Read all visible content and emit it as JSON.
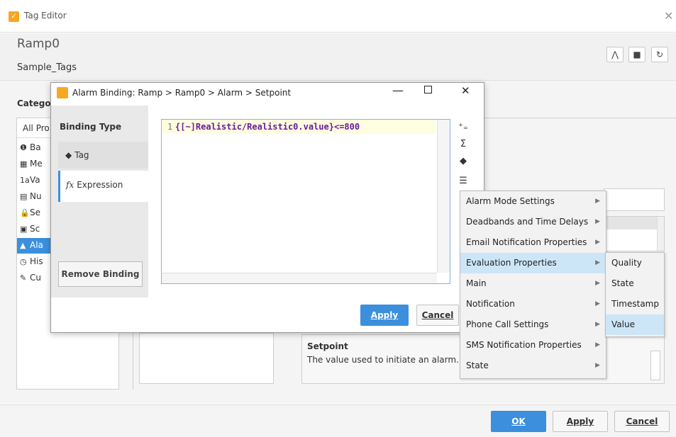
{
  "tag_editor": {
    "window_title": "Tag Editor",
    "tag_name": "Ramp0",
    "tag_path": "Sample_Tags",
    "category_label": "Categor",
    "all_props": "All Pro",
    "categories": [
      {
        "icon": "info-icon",
        "glyph": "❶",
        "label": "Ba"
      },
      {
        "icon": "meta-icon",
        "glyph": "▦",
        "label": "Me"
      },
      {
        "icon": "value-icon",
        "glyph": "1a",
        "label": "Va"
      },
      {
        "icon": "numeric-icon",
        "glyph": "▤",
        "label": "Nu"
      },
      {
        "icon": "security-icon",
        "glyph": "🔒",
        "label": "Se"
      },
      {
        "icon": "scripting-icon",
        "glyph": "▣",
        "label": "Sc"
      },
      {
        "icon": "alarm-icon",
        "glyph": "▲",
        "label": "Ala"
      },
      {
        "icon": "history-icon",
        "glyph": "◷",
        "label": "His"
      },
      {
        "icon": "custom-icon",
        "glyph": "✎",
        "label": "Cu"
      }
    ],
    "description_title": "Setpoint",
    "description_text": "The value used to initiate an alarm.",
    "footer": {
      "ok": "OK",
      "apply": "Apply",
      "cancel": "Cancel"
    }
  },
  "binding_dialog": {
    "title": "Alarm Binding: Ramp > Ramp0 > Alarm > Setpoint",
    "binding_type_label": "Binding Type",
    "types": [
      {
        "label": "Tag",
        "icon": "tag-icon"
      },
      {
        "label": "Expression",
        "icon": "fx-icon"
      }
    ],
    "remove_binding": "Remove Binding",
    "line_number": "1",
    "expression": "{[~]Realistic/Realistic0.value}<=800",
    "apply": "Apply",
    "cancel": "Cancel"
  },
  "menu": {
    "items": [
      "Alarm Mode Settings",
      "Deadbands and Time Delays",
      "Email Notification Properties",
      "Evaluation Properties",
      "Main",
      "Notification",
      "Phone Call Settings",
      "SMS Notification Properties",
      "State"
    ],
    "active_index": 3,
    "submenu": [
      "Quality",
      "State",
      "Timestamp",
      "Value"
    ],
    "submenu_active_index": 3
  }
}
